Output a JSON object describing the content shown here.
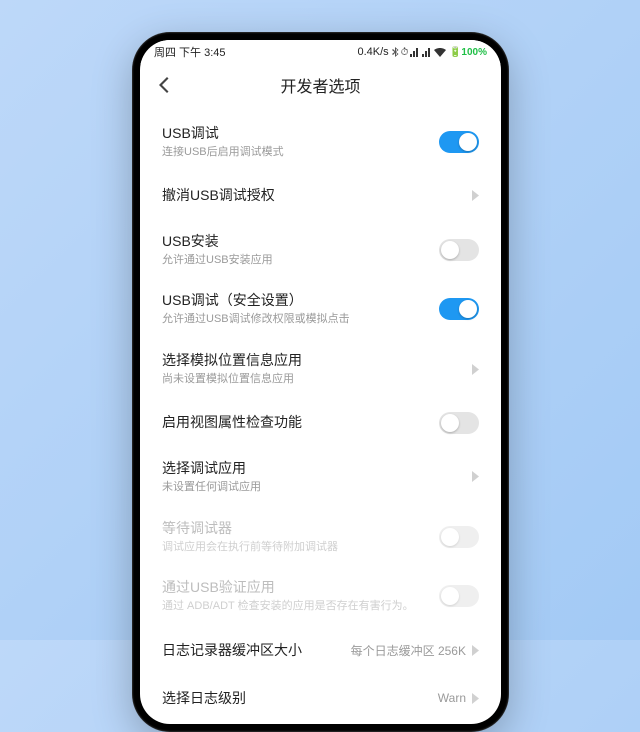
{
  "status": {
    "time": "周四 下午 3:45",
    "speed": "0.4K/s",
    "battery": "100%"
  },
  "header": {
    "title": "开发者选项"
  },
  "rows": {
    "usb_debug": {
      "title": "USB调试",
      "sub": "连接USB后启用调试模式"
    },
    "revoke_auth": {
      "title": "撤消USB调试授权"
    },
    "usb_install": {
      "title": "USB安装",
      "sub": "允许通过USB安装应用"
    },
    "usb_sec": {
      "title": "USB调试（安全设置）",
      "sub": "允许通过USB调试修改权限或模拟点击"
    },
    "mock_loc": {
      "title": "选择模拟位置信息应用",
      "sub": "尚未设置模拟位置信息应用"
    },
    "view_attr": {
      "title": "启用视图属性检查功能"
    },
    "debug_app": {
      "title": "选择调试应用",
      "sub": "未设置任何调试应用"
    },
    "wait_debugger": {
      "title": "等待调试器",
      "sub": "调试应用会在执行前等待附加调试器"
    },
    "usb_verify": {
      "title": "通过USB验证应用",
      "sub": "通过 ADB/ADT 检查安装的应用是否存在有害行为。"
    },
    "log_buffer": {
      "title": "日志记录器缓冲区大小",
      "value": "每个日志缓冲区 256K"
    },
    "log_level": {
      "title": "选择日志级别",
      "value": "Warn"
    }
  }
}
